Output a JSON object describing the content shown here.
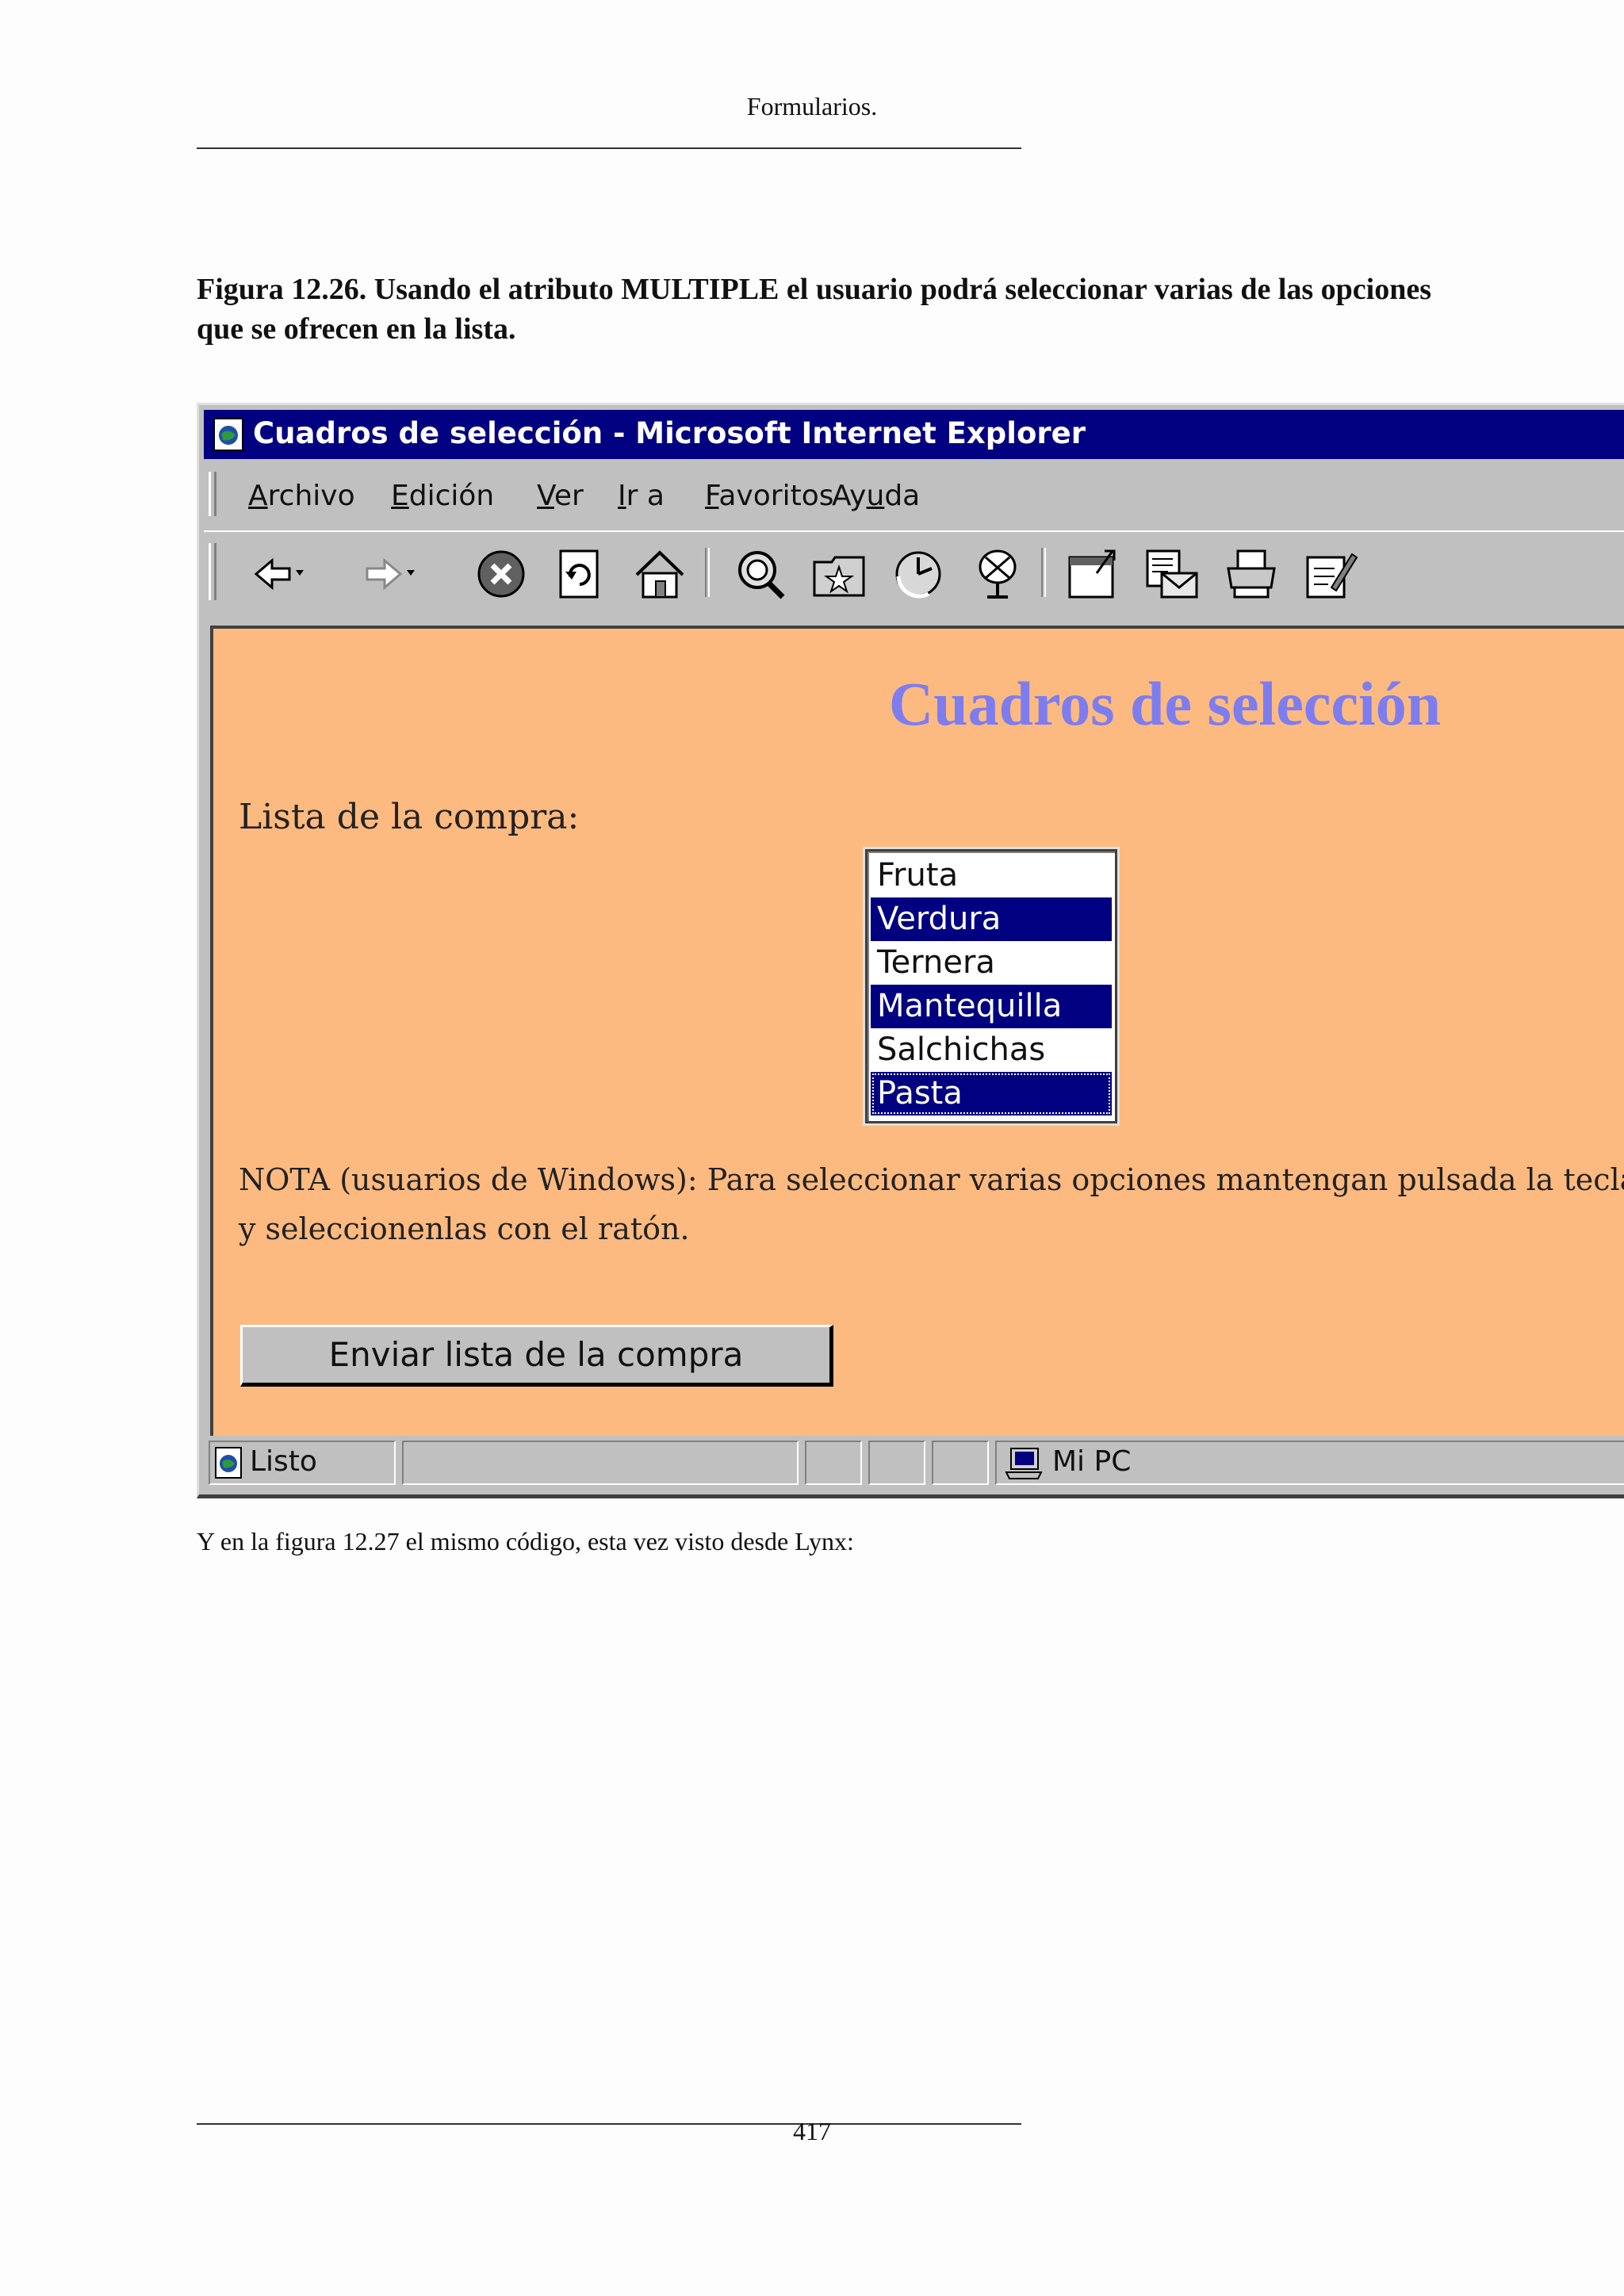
{
  "document": {
    "running_head": "Formularios.",
    "figure_caption": "Figura 12.26.  Usando el atributo MULTIPLE el usuario podrá seleccionar varias de las opciones que se ofrecen en la lista.",
    "body_text": "Y en la figura 12.27 el mismo código, esta vez visto desde Lynx:",
    "page_number": "417"
  },
  "browser": {
    "title": "Cuadros de selección - Microsoft Internet Explorer",
    "menu": [
      "Archivo",
      "Edición",
      "Ver",
      "Ir a",
      "Favoritos",
      "Ayuda"
    ],
    "menu_accel_index": [
      0,
      0,
      0,
      0,
      0,
      2
    ],
    "toolbar_icons": [
      "back-icon",
      "forward-icon",
      "stop-icon",
      "refresh-icon",
      "home-icon",
      "search-icon",
      "favorites-icon",
      "history-icon",
      "channels-icon",
      "fullscreen-icon",
      "mail-icon",
      "print-icon",
      "edit-icon"
    ],
    "status": {
      "text": "Listo",
      "zone": "Mi PC"
    },
    "colors": {
      "titlebar": "#000080",
      "chrome": "#c0c0c0",
      "page_bg": "#fdba80",
      "heading": "#7d7df0",
      "selected": "#000080"
    }
  },
  "page": {
    "heading": "Cuadros de selección",
    "list_label": "Lista de la compra:",
    "options": [
      {
        "label": "Fruta",
        "selected": false
      },
      {
        "label": "Verdura",
        "selected": true
      },
      {
        "label": "Ternera",
        "selected": false
      },
      {
        "label": "Mantequilla",
        "selected": true
      },
      {
        "label": "Salchichas",
        "selected": false
      },
      {
        "label": "Pasta",
        "selected": true,
        "focused": true
      }
    ],
    "note_line1": "NOTA (usuarios de Windows): Para seleccionar varias opciones mantengan pulsada la tecla co",
    "note_line2": "y seleccionenlas con el ratón.",
    "submit_label": "Enviar lista de la compra"
  }
}
